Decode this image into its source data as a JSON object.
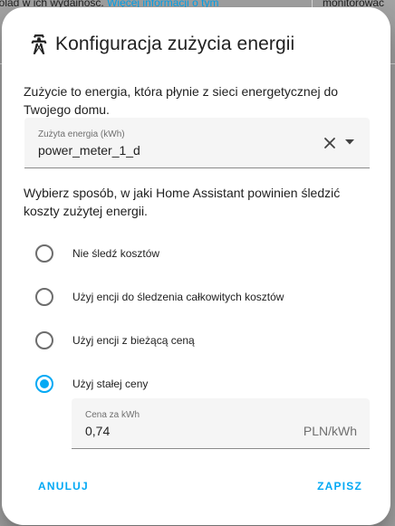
{
  "background": {
    "line1": "wolad w ich wydainość.",
    "line1_link": "Więcej informacji o tym",
    "line2": "monitorowac"
  },
  "dialog": {
    "title": "Konfiguracja zużycia energii",
    "description": "Zużycie to energia, która płynie z sieci energetycznej do Twojego domu.",
    "source_field": {
      "label": "Zużyta energia (kWh)",
      "value": "power_meter_1_d"
    },
    "cost_prompt": "Wybierz sposób, w jaki Home Assistant powinien śledzić koszty zużytej energii.",
    "options": [
      {
        "label": "Nie śledź kosztów",
        "checked": false
      },
      {
        "label": "Użyj encji do śledzenia całkowitych kosztów",
        "checked": false
      },
      {
        "label": "Użyj encji z bieżącą ceną",
        "checked": false
      },
      {
        "label": "Użyj stałej ceny",
        "checked": true
      }
    ],
    "price_field": {
      "label": "Cena za kWh",
      "value": "0,74",
      "unit": "PLN/kWh"
    },
    "cancel_label": "ANULUJ",
    "save_label": "ZAPISZ"
  },
  "colors": {
    "accent": "#03a9f4",
    "text": "#212121",
    "field_bg": "#f5f5f5",
    "scrim": "#7a7a7a"
  },
  "icons": {
    "title_icon": "transmission-tower-icon",
    "clear": "close-icon",
    "dropdown": "menu-down-icon"
  }
}
